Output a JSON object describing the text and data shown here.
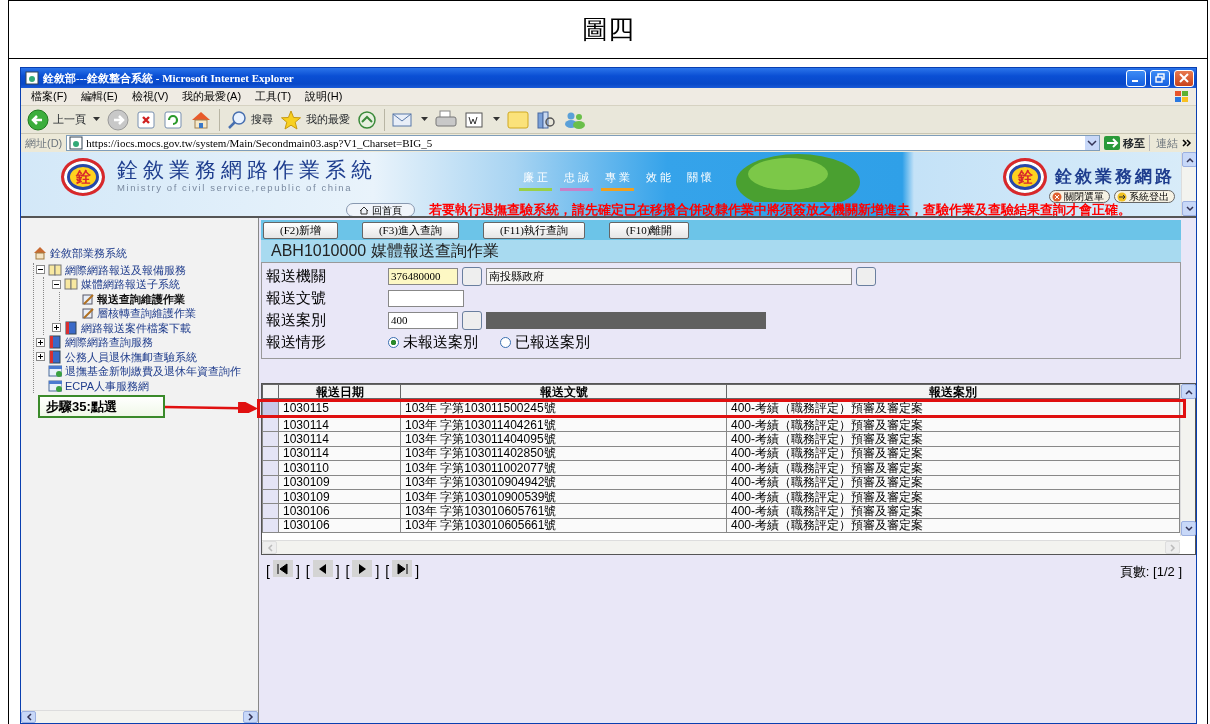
{
  "caption": "圖四",
  "window": {
    "title": "銓敘部---銓敘整合系統 - Microsoft Internet Explorer"
  },
  "menu": [
    "檔案(F)",
    "編輯(E)",
    "檢視(V)",
    "我的最愛(A)",
    "工具(T)",
    "說明(H)"
  ],
  "toolbar": {
    "back": "上一頁",
    "search": "搜尋",
    "favorites": "我的最愛"
  },
  "address": {
    "label": "網址(D)",
    "url": "https://iocs.mocs.gov.tw/system/Main/Secondmain03.asp?V1_Charset=BIG_5",
    "go": "移至",
    "links": "連結"
  },
  "banner": {
    "emblem": "銓",
    "brand_emblem": "銓",
    "title": "銓敘業務網路作業系統",
    "subtitle": "Ministry of civil service,republic of china",
    "mottos": [
      "廉 正",
      "忠 誠",
      "專 業",
      "效 能",
      "關 懷"
    ],
    "home": "回首頁",
    "notice": "若要執行退撫查驗系統，請先確定已在移撥合併改隸作業中將須簽放之機關新增進去，查驗作業及查驗結果查詢才會正確。",
    "brand": "銓敘業務網路",
    "buttons": [
      "關閉選單",
      "系統登出"
    ]
  },
  "sidebar": {
    "root": "銓敘部業務系統",
    "tree": [
      {
        "label": "網際網路報送及報備服務",
        "kind": "book",
        "expanded": true,
        "children": [
          {
            "label": "媒體網路報送子系統",
            "kind": "book",
            "expanded": true,
            "children": [
              {
                "label": "報送查詢維護作業",
                "kind": "page",
                "selected": true
              },
              {
                "label": "層核轉查詢維護作業",
                "kind": "page",
                "selected": false
              }
            ]
          },
          {
            "label": "網路報送案件檔案下載",
            "kind": "redbook",
            "expanded": false
          }
        ]
      },
      {
        "label": "網際網路查詢服務",
        "kind": "redbook",
        "expanded": false
      },
      {
        "label": "公務人員退休撫卹查驗系統",
        "kind": "redbook",
        "expanded": false
      },
      {
        "label": "退撫基金新制繳費及退休年資查詢作",
        "kind": "link"
      },
      {
        "label": "ECPA人事服務網",
        "kind": "link"
      }
    ]
  },
  "form": {
    "buttons": [
      "(F2)新增",
      "(F3)進入查詢",
      "(F11)執行查詢",
      "(F10)離開"
    ],
    "title": "ABH1010000 媒體報送查詢作業",
    "fields": [
      {
        "label": "報送機關",
        "kind": "lookup",
        "code": "376480000",
        "code_highlighted": true,
        "name": "南投縣政府",
        "name_disabled": false
      },
      {
        "label": "報送文號",
        "kind": "text"
      },
      {
        "label": "報送案別",
        "kind": "lookup",
        "code": "400",
        "code_highlighted": false,
        "name_disabled": true
      },
      {
        "label": "報送情形",
        "kind": "radio",
        "options": [
          {
            "label": "未報送案別",
            "selected": true
          },
          {
            "label": "已報送案別",
            "selected": false
          }
        ]
      }
    ]
  },
  "grid": {
    "columns": [
      "報送日期",
      "報送文號",
      "報送案別"
    ],
    "rows": [
      {
        "cells": [
          "1030115",
          "103年 字第103011500245號",
          "400-考績（職務評定）預審及審定案"
        ],
        "highlighted": true
      },
      {
        "cells": [
          "1030114",
          "103年 字第103011404261號",
          "400-考績（職務評定）預審及審定案"
        ],
        "highlighted": false
      },
      {
        "cells": [
          "1030114",
          "103年 字第103011404095號",
          "400-考績（職務評定）預審及審定案"
        ],
        "highlighted": false
      },
      {
        "cells": [
          "1030114",
          "103年 字第103011402850號",
          "400-考績（職務評定）預審及審定案"
        ],
        "highlighted": false
      },
      {
        "cells": [
          "1030110",
          "103年 字第103011002077號",
          "400-考績（職務評定）預審及審定案"
        ],
        "highlighted": false
      },
      {
        "cells": [
          "1030109",
          "103年 字第103010904942號",
          "400-考績（職務評定）預審及審定案"
        ],
        "highlighted": false
      },
      {
        "cells": [
          "1030109",
          "103年 字第103010900539號",
          "400-考績（職務評定）預審及審定案"
        ],
        "highlighted": false
      },
      {
        "cells": [
          "1030106",
          "103年 字第103010605761號",
          "400-考績（職務評定）預審及審定案"
        ],
        "highlighted": false
      },
      {
        "cells": [
          "1030106",
          "103年 字第103010605661號",
          "400-考績（職務評定）預審及審定案"
        ],
        "highlighted": false
      }
    ]
  },
  "pager": {
    "open": "[",
    "close": "]",
    "buttons": [
      {
        "kind": "first"
      },
      {
        "kind": "prev"
      },
      {
        "kind": "next"
      },
      {
        "kind": "last"
      }
    ],
    "info": "頁數: [1/2 ]"
  },
  "annotation": {
    "label": "步驟35:點選"
  }
}
